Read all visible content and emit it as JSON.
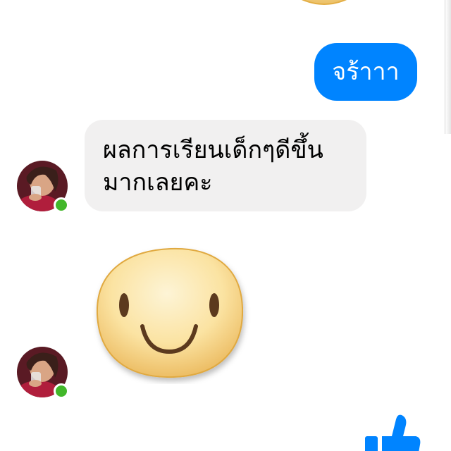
{
  "messages": [
    {
      "direction": "incoming",
      "type": "sticker",
      "sticker": "smiley-face-sticker"
    },
    {
      "direction": "outgoing",
      "type": "text",
      "text": "จร้าาา"
    },
    {
      "direction": "incoming",
      "type": "text",
      "lines": [
        "ผลการเรียนเด็กๆดีขึ้น",
        "มากเลยคะ"
      ]
    },
    {
      "direction": "incoming",
      "type": "sticker",
      "sticker": "smiley-face-sticker"
    }
  ],
  "contact": {
    "online": true
  },
  "icons": {
    "presence": "online-dot-icon",
    "like": "thumbs-up-icon"
  },
  "colors": {
    "outgoing_bubble": "#0084ff",
    "incoming_bubble": "#f1f0f0",
    "online": "#42b72a",
    "sticker_face": "#fbe3a0"
  }
}
